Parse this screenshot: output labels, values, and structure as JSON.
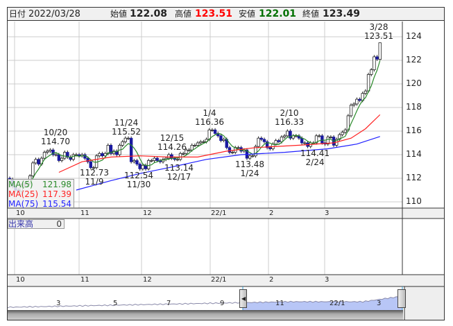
{
  "header": {
    "date_label": "日付",
    "date": "2022/03/28",
    "open_label": "始値",
    "open": "122.08",
    "high_label": "高値",
    "high": "123.51",
    "low_label": "安値",
    "low": "122.01",
    "close_label": "終値",
    "close": "123.49"
  },
  "legend": {
    "ma5_label": "MA(5)",
    "ma5": "121.98",
    "ma25_label": "MA(25)",
    "ma25": "117.39",
    "ma75_label": "MA(75)",
    "ma75": "115.54"
  },
  "volume": {
    "label": "出来高",
    "value": "0"
  },
  "annotations": {
    "a1": {
      "date": "10/20",
      "price": "114.70"
    },
    "a2": {
      "date": "11/24",
      "price": "115.52"
    },
    "a3": {
      "date": "12/15",
      "price": "114.26"
    },
    "a4": {
      "date": "1/4",
      "price": "116.36"
    },
    "a5": {
      "date": "2/10",
      "price": "116.33"
    },
    "a6": {
      "date": "3/28",
      "price": "123.51"
    },
    "b1": {
      "price": "112.73",
      "date": "11/9"
    },
    "b2": {
      "price": "112.54",
      "date": "11/30"
    },
    "b3": {
      "price": "113.14",
      "date": "12/17"
    },
    "b4": {
      "price": "113.48",
      "date": "1/24"
    },
    "b5": {
      "price": "114.41",
      "date": "2/24"
    }
  },
  "x_ticks": [
    "10",
    "11",
    "12",
    "22/1",
    "2",
    "3"
  ],
  "navigator_ticks": [
    "3",
    "5",
    "7",
    "9",
    "11",
    "22/1",
    "3"
  ],
  "colors": {
    "up": "#ffffff",
    "down": "#1a1aa0",
    "ma5": "#2a8a2a",
    "ma25": "#ff2020",
    "ma75": "#2020ff",
    "high": "#ff0000",
    "low": "#007000",
    "nav_fill": "#b8c6f6"
  },
  "chart_data": {
    "type": "candlestick",
    "title": "",
    "ylim": [
      109.5,
      125.3
    ],
    "y_ticks": [
      110,
      112,
      114,
      116,
      118,
      120,
      122,
      124
    ],
    "first_open": 112.0,
    "closes": [
      111.9,
      111.3,
      111.0,
      110.9,
      111.4,
      111.5,
      111.6,
      112.2,
      113.3,
      113.6,
      113.2,
      113.7,
      114.2,
      114.3,
      114.4,
      114.0,
      114.0,
      113.5,
      113.7,
      114.2,
      113.8,
      113.6,
      114.0,
      114.0,
      113.9,
      114.0,
      113.7,
      113.4,
      112.9,
      112.9,
      113.9,
      114.1,
      113.9,
      114.1,
      114.8,
      114.1,
      114.3,
      114.0,
      114.8,
      115.1,
      115.4,
      115.4,
      113.4,
      113.5,
      113.2,
      112.8,
      113.1,
      112.8,
      113.5,
      113.5,
      113.7,
      113.5,
      113.4,
      113.6,
      113.7,
      114.0,
      113.7,
      113.6,
      113.6,
      114.1,
      114.1,
      114.4,
      114.4,
      114.8,
      114.8,
      115.0,
      115.1,
      115.1,
      115.3,
      116.1,
      116.1,
      115.8,
      115.6,
      115.2,
      115.3,
      114.6,
      114.2,
      114.2,
      114.6,
      114.6,
      114.3,
      114.4,
      113.7,
      113.9,
      113.9,
      114.7,
      115.4,
      115.3,
      115.1,
      114.6,
      114.5,
      114.9,
      115.2,
      115.1,
      115.5,
      115.6,
      116.0,
      115.4,
      115.6,
      115.6,
      115.4,
      115.0,
      115.0,
      114.7,
      115.0,
      115.0,
      115.6,
      115.6,
      115.0,
      114.9,
      115.5,
      115.5,
      114.8,
      115.3,
      115.7,
      115.9,
      116.1,
      117.3,
      118.2,
      118.3,
      118.7,
      118.6,
      119.2,
      119.4,
      120.8,
      121.2,
      122.3,
      122.1,
      123.49
    ],
    "last_candle": {
      "open": 122.08,
      "high": 123.51,
      "low": 122.01,
      "close": 123.49
    },
    "ma25_points": [
      [
        17,
        112.5
      ],
      [
        25,
        113.4
      ],
      [
        35,
        113.8
      ],
      [
        45,
        113.9
      ],
      [
        55,
        113.8
      ],
      [
        65,
        113.8
      ],
      [
        75,
        114.3
      ],
      [
        85,
        114.6
      ],
      [
        100,
        114.8
      ],
      [
        112,
        115.0
      ],
      [
        118,
        115.4
      ],
      [
        123,
        116.2
      ],
      [
        128,
        117.39
      ]
    ],
    "ma75_points": [
      [
        23,
        111.0
      ],
      [
        35,
        111.8
      ],
      [
        45,
        112.4
      ],
      [
        55,
        112.9
      ],
      [
        68,
        113.6
      ],
      [
        80,
        114.0
      ],
      [
        95,
        114.2
      ],
      [
        110,
        114.5
      ],
      [
        120,
        114.9
      ],
      [
        128,
        115.54
      ]
    ]
  }
}
